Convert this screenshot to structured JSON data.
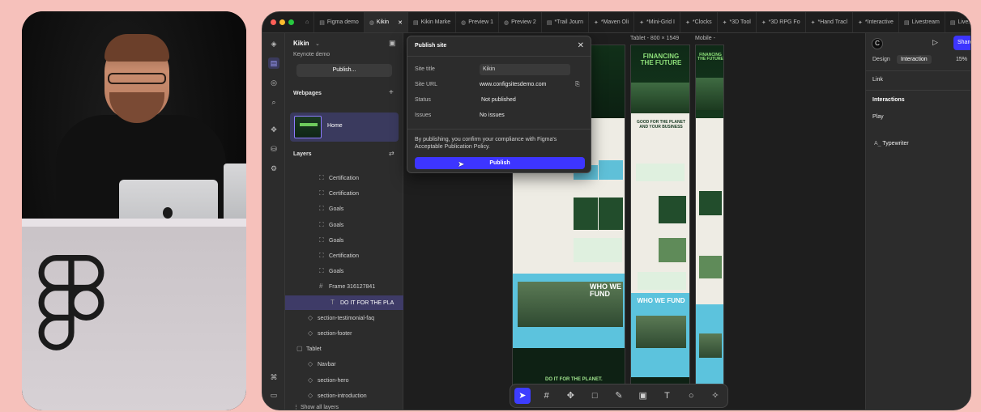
{
  "app": {
    "tabs": [
      {
        "label": "Figma demo",
        "icon": "file-icon"
      },
      {
        "label": "Kikin",
        "icon": "globe-icon",
        "active": true,
        "closable": true
      },
      {
        "label": "Kikin Marke",
        "icon": "file-icon"
      },
      {
        "label": "Preview 1",
        "icon": "globe-icon"
      },
      {
        "label": "Preview 2",
        "icon": "globe-icon"
      },
      {
        "label": "*Trail Journ",
        "icon": "file-icon"
      },
      {
        "label": "*Maven Oli",
        "icon": "grid-icon"
      },
      {
        "label": "*Mini-Grid I",
        "icon": "grid-icon"
      },
      {
        "label": "*Clocks",
        "icon": "grid-icon"
      },
      {
        "label": "*3D Tool",
        "icon": "grid-icon"
      },
      {
        "label": "*3D RPG Fo",
        "icon": "grid-icon"
      },
      {
        "label": "*Hand Tracl",
        "icon": "grid-icon"
      },
      {
        "label": "*Interactive",
        "icon": "grid-icon"
      },
      {
        "label": "Livestream",
        "icon": "file-icon"
      },
      {
        "label": "Livestream",
        "icon": "file-icon"
      }
    ]
  },
  "left_panel": {
    "project_title": "Kikin",
    "project_subtitle": "Keynote demo",
    "publish_button": "Publish...",
    "webpages_heading": "Webpages",
    "page_label": "Home",
    "layers_heading": "Layers",
    "layers": [
      {
        "label": "Certification",
        "icon": "frame-icon",
        "indent": 2
      },
      {
        "label": "Certification",
        "icon": "frame-icon",
        "indent": 2
      },
      {
        "label": "Goals",
        "icon": "frame-icon",
        "indent": 2
      },
      {
        "label": "Goals",
        "icon": "frame-icon",
        "indent": 2
      },
      {
        "label": "Goals",
        "icon": "frame-icon",
        "indent": 2
      },
      {
        "label": "Certification",
        "icon": "frame-icon",
        "indent": 2
      },
      {
        "label": "Goals",
        "icon": "frame-icon",
        "indent": 2
      },
      {
        "label": "Frame 316127841",
        "icon": "hash-icon",
        "indent": 2
      },
      {
        "label": "DO IT FOR THE PLA",
        "icon": "text-icon",
        "indent": 3,
        "selected": true
      },
      {
        "label": "section-testimonial-faq",
        "icon": "component-icon",
        "indent": 1
      },
      {
        "label": "section-footer",
        "icon": "component-icon",
        "indent": 1
      },
      {
        "label": "Tablet",
        "icon": "breakpoint-icon",
        "indent": 0
      },
      {
        "label": "Navbar",
        "icon": "component-icon",
        "indent": 1
      },
      {
        "label": "section-hero",
        "icon": "component-icon",
        "indent": 1
      },
      {
        "label": "section-introduction",
        "icon": "component-icon",
        "indent": 1
      }
    ],
    "show_all_layers": "Show all layers"
  },
  "canvas": {
    "frame_labels": [
      "Tablet - 800 × 1549",
      "Mobile -"
    ],
    "tablet_headline": "FINANCING THE FUTURE",
    "mobile_headline": "FINANCING THE FUTURE",
    "tablet_sub": "GOOD FOR THE PLANET AND YOUR BUSINESS",
    "who_we_fund": "WHO WE FUND",
    "do_it": "DO IT FOR THE PLANET."
  },
  "publish_modal": {
    "title": "Publish site",
    "site_title_label": "Site title",
    "site_title_value": "Kikin",
    "site_url_label": "Site URL",
    "site_url_value": "www.configsitesdemo.com",
    "status_label": "Status",
    "status_value": "Not published",
    "issues_label": "Issues",
    "issues_value": "No issues",
    "notice": "By publishing, you confirm your compliance with Figma's Acceptable Publication Policy.",
    "publish_button": "Publish"
  },
  "right_panel": {
    "share_label": "Share",
    "tab_design": "Design",
    "tab_interaction": "Interaction",
    "zoom": "15%",
    "link_heading": "Link",
    "interactions_heading": "Interactions",
    "trigger": "Play",
    "effect": "Typewriter"
  },
  "colors": {
    "background": "#f6c1bb",
    "accent": "#3d35ff",
    "selection": "#3e3b67",
    "site_green": "#0f2515",
    "site_lime": "#6ecb5c"
  }
}
